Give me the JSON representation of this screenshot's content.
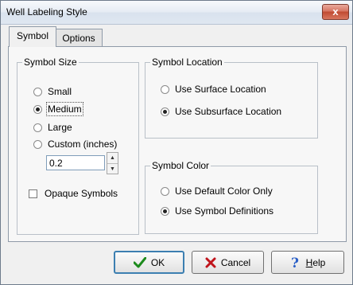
{
  "window": {
    "title": "Well Labeling Style",
    "close_label": "x"
  },
  "tabs": [
    {
      "label": "Symbol"
    },
    {
      "label": "Options"
    }
  ],
  "symbol_size": {
    "group_label": "Symbol Size",
    "options": [
      {
        "label": "Small",
        "selected": false
      },
      {
        "label": "Medium",
        "selected": true
      },
      {
        "label": "Large",
        "selected": false
      },
      {
        "label": "Custom (inches)",
        "selected": false
      }
    ],
    "custom_value": "0.2",
    "opaque_label": "Opaque Symbols",
    "opaque_checked": false
  },
  "symbol_location": {
    "group_label": "Symbol Location",
    "options": [
      {
        "label": "Use Surface Location",
        "selected": false
      },
      {
        "label": "Use Subsurface Location",
        "selected": true
      }
    ]
  },
  "symbol_color": {
    "group_label": "Symbol Color",
    "options": [
      {
        "label": "Use Default Color Only",
        "selected": false
      },
      {
        "label": "Use Symbol Definitions",
        "selected": true
      }
    ]
  },
  "buttons": {
    "ok": "OK",
    "cancel": "Cancel",
    "help_first": "H",
    "help_rest": "elp"
  },
  "colors": {
    "ok_check": "#1c8a1c",
    "cancel_x": "#c0141b",
    "help_q": "#2a5fc7"
  },
  "icons": {
    "ok": "check-icon",
    "cancel": "x-icon",
    "help": "question-icon"
  }
}
